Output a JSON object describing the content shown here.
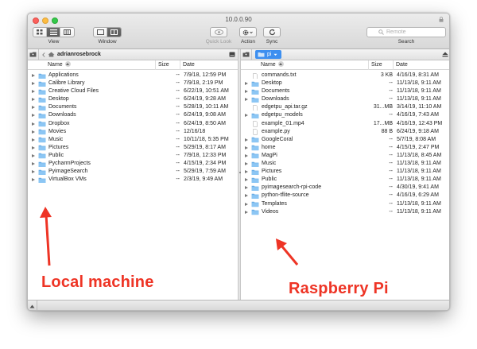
{
  "window": {
    "title": "10.0.0.90"
  },
  "toolbar": {
    "view_label": "View",
    "window_label": "Window",
    "quicklook_label": "Quick Look",
    "action_label": "Action",
    "sync_label": "Sync",
    "search_label": "Search",
    "search_placeholder": "Remote"
  },
  "left_pane": {
    "path_label": "adrianrosebrock",
    "columns": {
      "name": "Name",
      "size": "Size",
      "date": "Date"
    },
    "items": [
      {
        "name": "Applications",
        "size": "--",
        "date": "7/9/18, 12:59 PM",
        "type": "folder"
      },
      {
        "name": "Calibre Library",
        "size": "--",
        "date": "7/9/18, 2:19 PM",
        "type": "folder"
      },
      {
        "name": "Creative Cloud Files",
        "size": "--",
        "date": "6/22/19, 10:51 AM",
        "type": "folder"
      },
      {
        "name": "Desktop",
        "size": "--",
        "date": "6/24/19, 9:28 AM",
        "type": "folder"
      },
      {
        "name": "Documents",
        "size": "--",
        "date": "5/28/19, 10:11 AM",
        "type": "folder"
      },
      {
        "name": "Downloads",
        "size": "--",
        "date": "6/24/19, 9:08 AM",
        "type": "folder"
      },
      {
        "name": "Dropbox",
        "size": "--",
        "date": "6/24/19, 8:50 AM",
        "type": "folder"
      },
      {
        "name": "Movies",
        "size": "--",
        "date": "12/16/18",
        "type": "folder"
      },
      {
        "name": "Music",
        "size": "--",
        "date": "10/11/18, 5:35 PM",
        "type": "folder"
      },
      {
        "name": "Pictures",
        "size": "--",
        "date": "5/29/19, 8:17 AM",
        "type": "folder"
      },
      {
        "name": "Public",
        "size": "--",
        "date": "7/9/18, 12:33 PM",
        "type": "folder"
      },
      {
        "name": "PycharmProjects",
        "size": "--",
        "date": "4/15/19, 2:34 PM",
        "type": "folder"
      },
      {
        "name": "PyimageSearch",
        "size": "--",
        "date": "5/29/19, 7:59 AM",
        "type": "folder"
      },
      {
        "name": "VirtualBox VMs",
        "size": "--",
        "date": "2/3/19, 9:49 AM",
        "type": "folder"
      }
    ]
  },
  "right_pane": {
    "path_label": "pi",
    "columns": {
      "name": "Name",
      "size": "Size",
      "date": "Date"
    },
    "items": [
      {
        "name": "commands.txt",
        "size": "3 KB",
        "date": "4/16/19, 8:31 AM",
        "type": "file"
      },
      {
        "name": "Desktop",
        "size": "--",
        "date": "11/13/18, 9:11 AM",
        "type": "folder"
      },
      {
        "name": "Documents",
        "size": "--",
        "date": "11/13/18, 9:11 AM",
        "type": "folder"
      },
      {
        "name": "Downloads",
        "size": "--",
        "date": "11/13/18, 9:11 AM",
        "type": "folder"
      },
      {
        "name": "edgetpu_api.tar.gz",
        "size": "31...MB",
        "date": "3/14/19, 11:10 AM",
        "type": "file"
      },
      {
        "name": "edgetpu_models",
        "size": "--",
        "date": "4/16/19, 7:43 AM",
        "type": "folder"
      },
      {
        "name": "example_01.mp4",
        "size": "17...MB",
        "date": "4/16/19, 12:43 PM",
        "type": "file"
      },
      {
        "name": "example.py",
        "size": "88 B",
        "date": "6/24/19, 9:18 AM",
        "type": "file"
      },
      {
        "name": "GoogleCoral",
        "size": "--",
        "date": "5/7/19, 8:08 AM",
        "type": "folder"
      },
      {
        "name": "home",
        "size": "--",
        "date": "4/15/19, 2:47 PM",
        "type": "folder"
      },
      {
        "name": "MagPi",
        "size": "--",
        "date": "11/13/18, 8:45 AM",
        "type": "folder"
      },
      {
        "name": "Music",
        "size": "--",
        "date": "11/13/18, 9:11 AM",
        "type": "folder"
      },
      {
        "name": "Pictures",
        "size": "--",
        "date": "11/13/18, 9:11 AM",
        "type": "folder"
      },
      {
        "name": "Public",
        "size": "--",
        "date": "11/13/18, 9:11 AM",
        "type": "folder"
      },
      {
        "name": "pyimagesearch-rpi-code",
        "size": "--",
        "date": "4/30/19, 9:41 AM",
        "type": "folder"
      },
      {
        "name": "python-tflite-source",
        "size": "--",
        "date": "4/16/19, 6:29 AM",
        "type": "folder"
      },
      {
        "name": "Templates",
        "size": "--",
        "date": "11/13/18, 9:11 AM",
        "type": "folder"
      },
      {
        "name": "Videos",
        "size": "--",
        "date": "11/13/18, 9:11 AM",
        "type": "folder"
      }
    ]
  },
  "annotations": {
    "left": "Local machine",
    "right": "Raspberry Pi",
    "color": "#ee3425"
  },
  "colors": {
    "folder": "#8cc6f4",
    "highlight": "#3d8ff0"
  }
}
